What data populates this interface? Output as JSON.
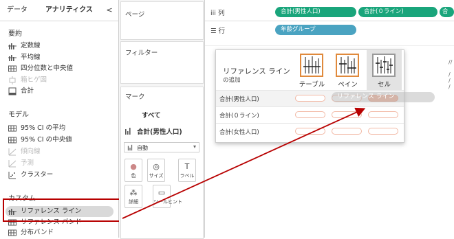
{
  "tabs": {
    "data": "データ",
    "analytics": "アナリティクス",
    "collapse": "<"
  },
  "sections": {
    "summary": {
      "title": "要約",
      "items": [
        {
          "label": "定数線",
          "icon": "constant-line-icon",
          "enabled": true
        },
        {
          "label": "平均線",
          "icon": "average-line-icon",
          "enabled": true
        },
        {
          "label": "四分位数と中央値",
          "icon": "quartile-icon",
          "enabled": true
        },
        {
          "label": "箱ヒゲ図",
          "icon": "box-plot-icon",
          "enabled": false
        },
        {
          "label": "合計",
          "icon": "totals-icon",
          "enabled": true
        }
      ]
    },
    "model": {
      "title": "モデル",
      "items": [
        {
          "label": "95% CI の平均",
          "icon": "ci-mean-icon",
          "enabled": true
        },
        {
          "label": "95% CI の中央値",
          "icon": "ci-median-icon",
          "enabled": true
        },
        {
          "label": "傾向線",
          "icon": "trend-line-icon",
          "enabled": false
        },
        {
          "label": "予測",
          "icon": "forecast-icon",
          "enabled": false
        },
        {
          "label": "クラスター",
          "icon": "cluster-icon",
          "enabled": true
        }
      ]
    },
    "custom": {
      "title": "カスタム",
      "items": [
        {
          "label": "リファレンス ライン",
          "icon": "reference-line-icon",
          "enabled": true
        },
        {
          "label": "リファレンス バンド",
          "icon": "reference-band-icon",
          "enabled": true
        },
        {
          "label": "分布バンド",
          "icon": "distribution-band-icon",
          "enabled": true
        }
      ]
    }
  },
  "cards": {
    "pages": "ページ",
    "filters": "フィルター",
    "marks": "マーク",
    "marks_all": "すべて",
    "marks_measure": "合計(男性人口)",
    "mark_type": "自動",
    "buttons": [
      {
        "label": "色",
        "icon": "color-icon"
      },
      {
        "label": "サイズ",
        "icon": "size-icon"
      },
      {
        "label": "ラベル",
        "icon": "label-icon"
      },
      {
        "label": "詳細",
        "icon": "detail-icon"
      },
      {
        "label": "ツールヒント",
        "icon": "tooltip-icon"
      }
    ]
  },
  "shelves": {
    "columns_label": "列",
    "rows_label": "行",
    "columns_pills": [
      "合計(男性人口)",
      "合計(０ライン)",
      "合計"
    ],
    "rows_pills": [
      "年齢グループ"
    ]
  },
  "dialog": {
    "title": "リファレンス ライン",
    "subtitle": "の追加",
    "scopes": [
      "テーブル",
      "ペイン",
      "セル"
    ],
    "rows": [
      "合計(男性人口)",
      "合計(０ライン)",
      "合計(女性人口)"
    ],
    "drag_label": "リファレンス ライン"
  },
  "colors": {
    "pill_green": "#19a57b",
    "pill_blue": "#4aa3c1",
    "highlight_red": "#b80000",
    "accent_orange": "#e08a3c"
  }
}
